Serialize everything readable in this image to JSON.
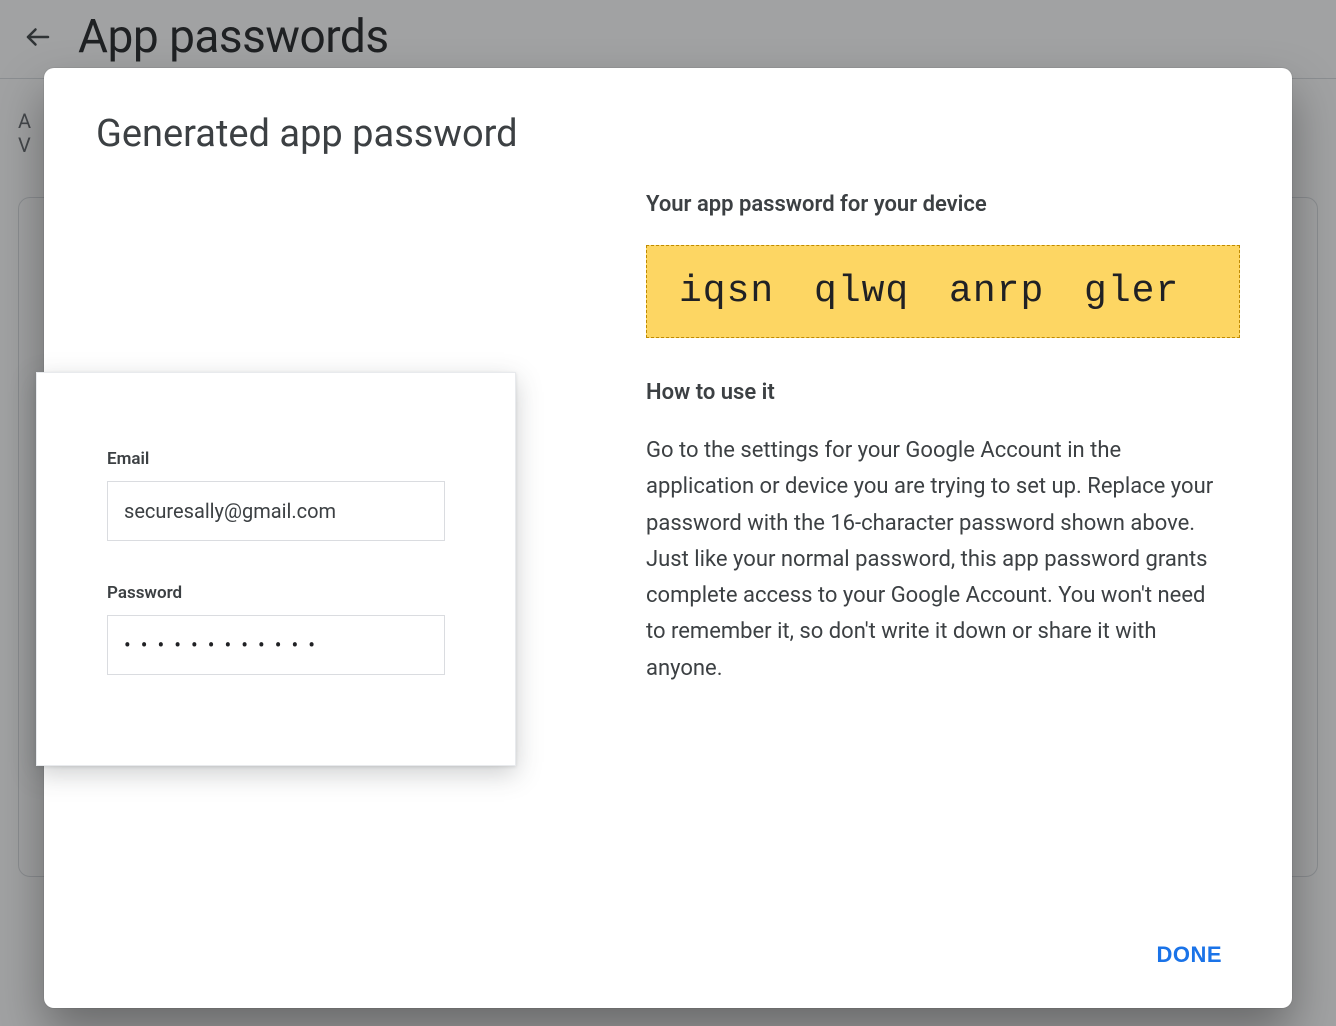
{
  "page": {
    "title": "App passwords",
    "body_teaser_line1": "A",
    "body_teaser_line2": "V"
  },
  "dialog": {
    "title": "Generated app password",
    "right": {
      "heading": "Your app password for your device",
      "password": "iqsn qlwq anrp gler",
      "how_heading": "How to use it",
      "instructions": "Go to the settings for your Google Account in the application or device you are trying to set up. Replace your password with the 16-character password shown above.\nJust like your normal password, this app password grants complete access to your Google Account. You won't need to remember it, so don't write it down or share it with anyone."
    },
    "login_mock": {
      "email_label": "Email",
      "email_value": "securesally@gmail.com",
      "password_label": "Password",
      "password_dots": "••••••••••••"
    },
    "done_label": "DONE"
  }
}
